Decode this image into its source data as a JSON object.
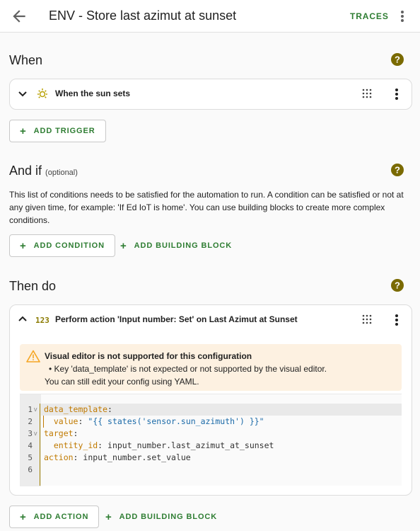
{
  "header": {
    "title": "ENV - Store last azimut at sunset",
    "traces_label": "TRACES"
  },
  "when": {
    "title": "When",
    "trigger_label": "When the sun sets",
    "add_trigger_label": "ADD TRIGGER"
  },
  "and_if": {
    "title": "And if",
    "optional_label": "(optional)",
    "description": "This list of conditions needs to be satisfied for the automation to run. A condition can be satisfied or not at any given time, for example: 'If Ed IoT is home'. You can use building blocks to create more complex conditions.",
    "add_condition_label": "ADD CONDITION",
    "add_building_block_label": "ADD BUILDING BLOCK"
  },
  "then_do": {
    "title": "Then do",
    "action_label": "Perform action 'Input number: Set' on Last Azimut at Sunset",
    "warning_title": "Visual editor is not supported for this configuration",
    "warning_bullet": "Key 'data_template' is not expected or not supported by the visual editor.",
    "warning_footer": "You can still edit your config using YAML.",
    "add_action_label": "ADD ACTION",
    "add_building_block_label": "ADD BUILDING BLOCK"
  },
  "yaml": {
    "line_numbers": [
      "1",
      "2",
      "3",
      "4",
      "5",
      "6"
    ],
    "line1_key": "data_template",
    "line2_key": "value",
    "line2_val": "\"{{ states('sensor.sun_azimuth') }}\"",
    "line3_key": "target",
    "line4_key": "entity_id",
    "line4_val": "input_number.last_azimut_at_sunset",
    "line5_key": "action",
    "line5_val": "input_number.set_value"
  },
  "colors": {
    "accent_green": "#2e7d32",
    "help_olive": "#7a6a00",
    "warning_bg": "#fdf1e1",
    "warning_orange": "#f5a623"
  }
}
